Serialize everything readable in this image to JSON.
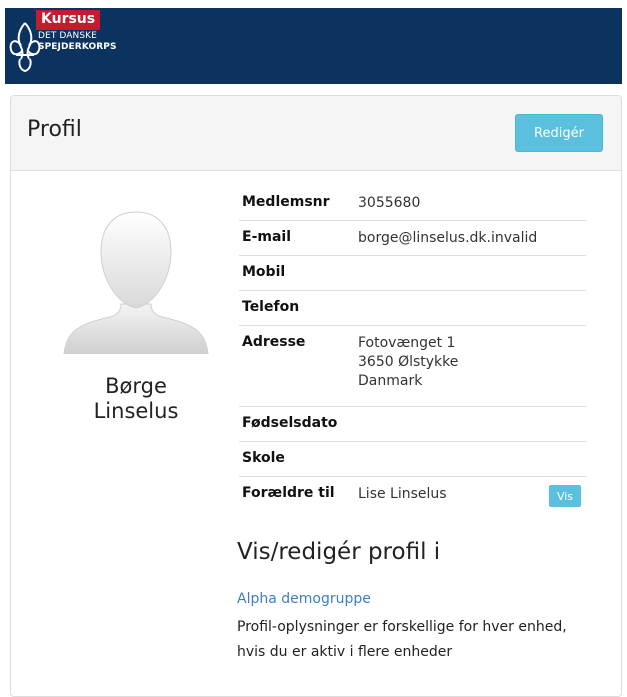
{
  "header": {
    "badge": "Kursus",
    "org_line1": "DET DANSKE",
    "org_line2": "SPEJDERKORPS",
    "logo_icon": "fleur-de-lis-icon",
    "brand_colors": {
      "bar": "#0c3360",
      "badge": "#c41b2e"
    }
  },
  "panel": {
    "title": "Profil",
    "edit_label": "Redigér"
  },
  "profile": {
    "first_name": "Børge",
    "last_name": "Linselus",
    "avatar_icon": "default-avatar-silhouette"
  },
  "fields": [
    {
      "label": "Medlemsnr",
      "value": "3055680"
    },
    {
      "label": "E-mail",
      "value": "borge@linselus.dk.invalid"
    },
    {
      "label": "Mobil",
      "value": ""
    },
    {
      "label": "Telefon",
      "value": ""
    },
    {
      "label": "Adresse",
      "lines": [
        "Fotovænget 1",
        "3650 Ølstykke",
        "Danmark"
      ]
    },
    {
      "label": "Fødselsdato",
      "value": ""
    },
    {
      "label": "Skole",
      "value": ""
    },
    {
      "label": "Forældre til",
      "value": "Lise Linselus",
      "action_label": "Vis"
    }
  ],
  "section": {
    "title": "Vis/redigér profil i",
    "group_link": "Alpha demogruppe",
    "description": "Profil-oplysninger er forskellige for hver enhed, hvis du er aktiv i flere enheder"
  },
  "colors": {
    "info_button": "#5bc0de",
    "link": "#3f7fc1"
  }
}
